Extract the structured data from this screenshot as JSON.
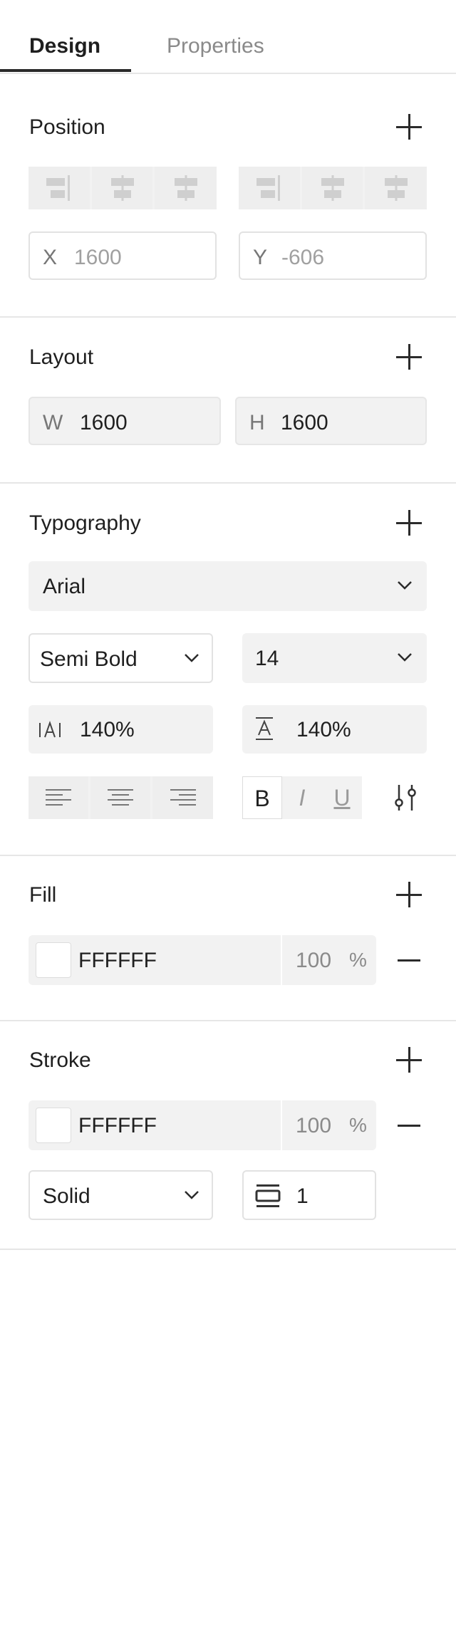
{
  "tabs": [
    {
      "label": "Design"
    },
    {
      "label": "Properties"
    }
  ],
  "position": {
    "title": "Position",
    "x_label": "X",
    "x_value": "1600",
    "y_label": "Y",
    "y_value": "-606"
  },
  "layout": {
    "title": "Layout",
    "w_label": "W",
    "w_value": "1600",
    "h_label": "H",
    "h_value": "1600"
  },
  "typography": {
    "title": "Typography",
    "font_family": "Arial",
    "font_weight": "Semi Bold",
    "font_size": "14",
    "letter_spacing": "140%",
    "line_height": "140%",
    "bold": "B",
    "italic": "I",
    "underline": "U",
    "icons": [
      "align-left-icon",
      "align-center-icon",
      "align-right-icon",
      "letter-spacing-icon",
      "line-height-icon",
      "sliders-icon"
    ]
  },
  "fill": {
    "title": "Fill",
    "hex": "FFFFFF",
    "opacity": "100",
    "unit": "%",
    "color": "#FFFFFF"
  },
  "stroke": {
    "title": "Stroke",
    "hex": "FFFFFF",
    "opacity": "100",
    "unit": "%",
    "color": "#FFFFFF",
    "style": "Solid",
    "width": "1"
  },
  "colors": {
    "accent": "#2A2A2A",
    "panel": "#F2F2F2",
    "border": "#E2E2E2"
  }
}
